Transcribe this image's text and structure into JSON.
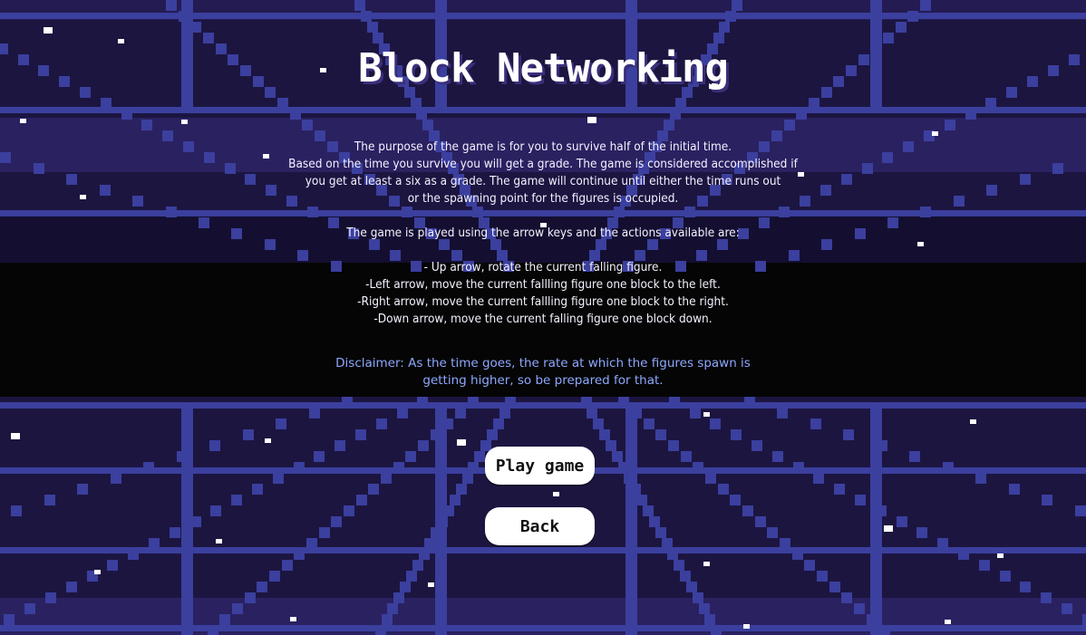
{
  "title": "Block Networking",
  "instructions": {
    "line1": "The purpose of the game is for you to survive  half of the initial time.",
    "line2": "Based on the time you survive you will get a grade. The game is considered accomplished if",
    "line3": "you get at least a six as a grade. The game will continue until either the time runs out",
    "line4": "or the spawning point for the figures is occupied.",
    "controls_intro": "The game is played using the arrow keys and the actions available are:",
    "control_up": "- Up arrow, rotate the current falling figure.",
    "control_left": "-Left arrow, move the current fallling figure one block to the left.",
    "control_right": "-Right arrow, move the current fallling figure one block to the right.",
    "control_down": "-Down arrow, move the current falling figure one block down."
  },
  "disclaimer": {
    "line1": "Disclaimer: As the time goes, the rate at which the figures spawn is",
    "line2": "getting higher, so be prepared for that."
  },
  "buttons": {
    "play": "Play game",
    "back": "Back"
  },
  "colors": {
    "background": "#1c1540",
    "grid": "#3b3f9e",
    "band": "#2a2160",
    "dark_band": "#050505",
    "disclaimer": "#8ea8ff",
    "button": "#ffffff"
  }
}
